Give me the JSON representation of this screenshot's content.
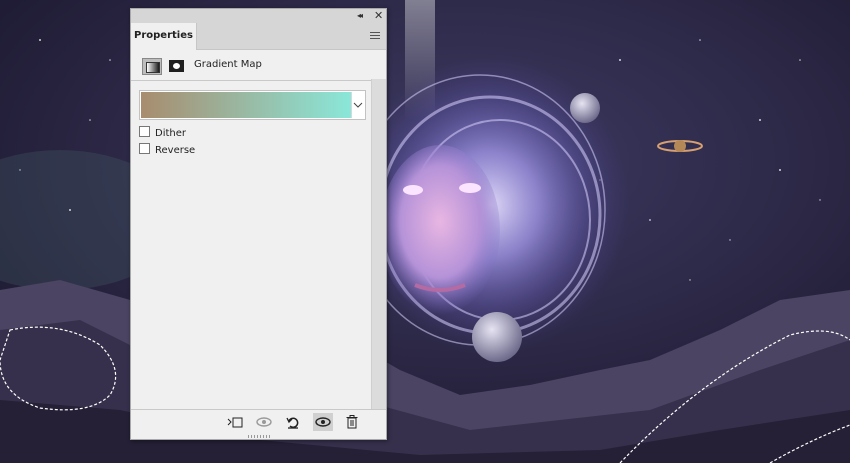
{
  "panel": {
    "window_controls": {
      "collapse": "◂◂",
      "close": "✕"
    },
    "tab": "Properties",
    "menu_icon": "panel-menu-icon",
    "adjustment": {
      "icon": "gradient-map-adjustment-icon",
      "mask_icon": "layer-mask-icon",
      "title": "Gradient Map"
    },
    "gradient": {
      "start_color": "#a88c6e",
      "end_color": "#8ae7d9"
    },
    "options": [
      {
        "label": "Dither",
        "checked": false
      },
      {
        "label": "Reverse",
        "checked": false
      }
    ],
    "toolbar": [
      {
        "icon": "clip-to-layer-icon"
      },
      {
        "icon": "view-previous-state-icon"
      },
      {
        "icon": "reset-to-defaults-icon"
      },
      {
        "icon": "toggle-visibility-icon"
      },
      {
        "icon": "delete-icon"
      }
    ]
  }
}
